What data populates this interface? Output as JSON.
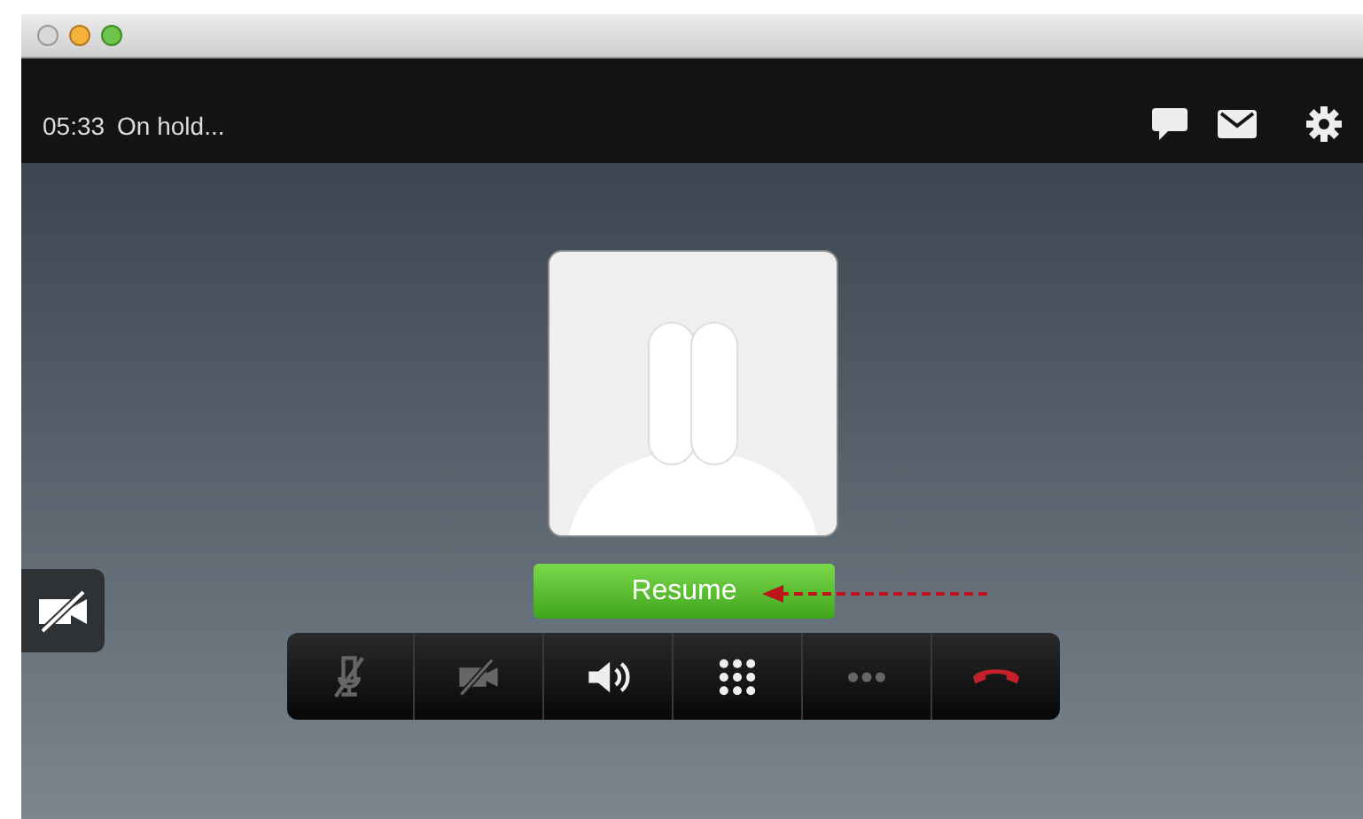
{
  "call": {
    "timer": "05:33",
    "status": "On hold..."
  },
  "resume_button": {
    "label": "Resume"
  },
  "controls": [
    {
      "kind": "mute",
      "disabled": true
    },
    {
      "kind": "video",
      "disabled": true
    },
    {
      "kind": "speaker",
      "disabled": false
    },
    {
      "kind": "keypad",
      "disabled": false
    },
    {
      "kind": "more",
      "disabled": true
    },
    {
      "kind": "hangup",
      "disabled": false
    }
  ]
}
